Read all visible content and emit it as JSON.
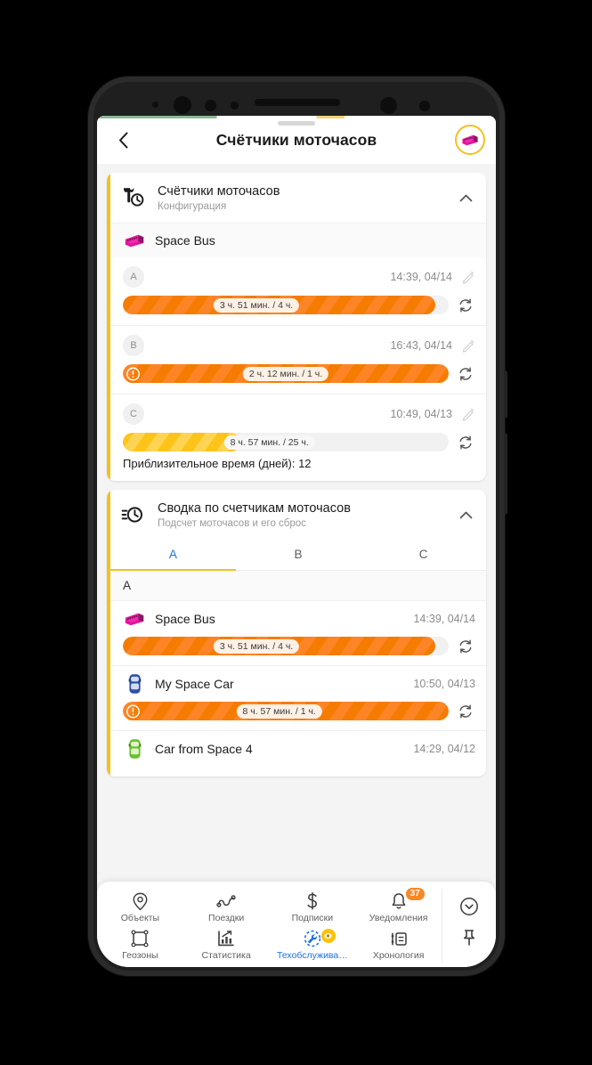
{
  "header": {
    "title": "Счётчики моточасов",
    "back_icon": "chevron-left-icon",
    "avatar_icon": "bus-icon"
  },
  "cards": [
    {
      "icon": "wrench-clock-icon",
      "title": "Счётчики моточасов",
      "subtitle": "Конфигурация",
      "collapse_icon": "chevron-up-icon",
      "object": {
        "name": "Space Bus",
        "icon": "bus-icon"
      },
      "counters": [
        {
          "letter": "A",
          "time": "14:39, 04/14",
          "bar_label": "3 ч. 51 мин. / 4 ч.",
          "fill_percent": 96,
          "color": "orange",
          "warning": false,
          "label_pos": 41
        },
        {
          "letter": "B",
          "time": "16:43, 04/14",
          "bar_label": "2 ч. 12 мин. / 1 ч.",
          "fill_percent": 100,
          "color": "orange",
          "warning": true,
          "label_pos": 50
        },
        {
          "letter": "C",
          "time": "10:49, 04/13",
          "bar_label": "8 ч. 57 мин. / 25 ч.",
          "fill_percent": 36,
          "color": "yellow",
          "warning": false,
          "label_pos": 45,
          "pale_label": true,
          "note": "Приблизительное время (дней): 12"
        }
      ]
    },
    {
      "icon": "clock-motion-icon",
      "title": "Сводка по счетчикам моточасов",
      "subtitle": "Подсчет моточасов и его сброс",
      "collapse_icon": "chevron-up-icon",
      "tabs": [
        {
          "label": "A",
          "active": true
        },
        {
          "label": "B",
          "active": false
        },
        {
          "label": "C",
          "active": false
        }
      ],
      "group_label": "A",
      "items": [
        {
          "name": "Space Bus",
          "icon": "bus-icon",
          "time": "14:39, 04/14",
          "bar_label": "3 ч. 51 мин. / 4 ч.",
          "fill_percent": 96,
          "color": "orange",
          "warning": false,
          "label_pos": 41
        },
        {
          "name": "My Space Car",
          "icon": "car-blue-icon",
          "time": "10:50, 04/13",
          "bar_label": "8 ч. 57 мин. / 1 ч.",
          "fill_percent": 100,
          "color": "orange",
          "warning": true,
          "label_pos": 48
        },
        {
          "name": "Car from Space 4",
          "icon": "car-green-icon",
          "time": "14:29, 04/12"
        }
      ]
    }
  ],
  "bottom_nav": {
    "items": [
      {
        "label": "Объекты",
        "icon": "location-pin-icon",
        "active": false
      },
      {
        "label": "Поездки",
        "icon": "route-icon",
        "active": false
      },
      {
        "label": "Подписки",
        "icon": "dollar-icon",
        "active": false
      },
      {
        "label": "Уведомления",
        "icon": "bell-icon",
        "active": false,
        "badge": "37"
      },
      {
        "label": "Геозоны",
        "icon": "geofence-icon",
        "active": false
      },
      {
        "label": "Статистика",
        "icon": "bar-chart-icon",
        "active": false
      },
      {
        "label": "Техобслужива…",
        "icon": "maintenance-icon",
        "active": true,
        "eye_badge": true
      },
      {
        "label": "Хронология",
        "icon": "timeline-icon",
        "active": false
      }
    ],
    "side": [
      {
        "icon": "chevron-down-circle-icon"
      },
      {
        "icon": "pin-icon"
      }
    ]
  },
  "colors": {
    "accent_yellow": "#f4c020",
    "orange": "#f57c00",
    "yellow": "#fcc419",
    "blue": "#1a73e8",
    "badge_orange": "#f98824"
  }
}
